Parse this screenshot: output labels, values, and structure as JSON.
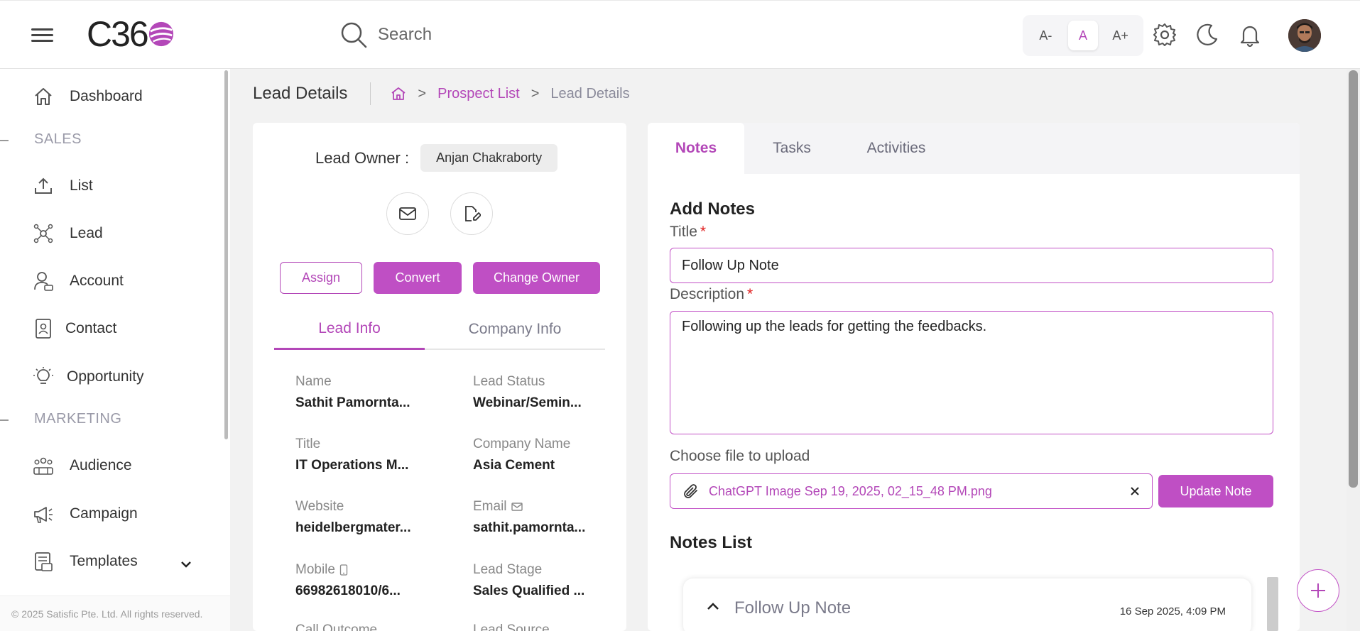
{
  "header": {
    "logo_text": "C36",
    "search_placeholder": "Search",
    "font_controls": [
      "A-",
      "A",
      "A+"
    ]
  },
  "sidebar": {
    "items": [
      {
        "label": "Dashboard",
        "icon": "home-icon"
      },
      {
        "label": "List",
        "icon": "upload-icon"
      },
      {
        "label": "Lead",
        "icon": "network-icon"
      },
      {
        "label": "Account",
        "icon": "user-account-icon"
      },
      {
        "label": "Contact",
        "icon": "contact-card-icon"
      },
      {
        "label": "Opportunity",
        "icon": "lightbulb-icon"
      },
      {
        "label": "Audience",
        "icon": "audience-icon"
      },
      {
        "label": "Campaign",
        "icon": "megaphone-icon"
      },
      {
        "label": "Templates",
        "icon": "templates-icon"
      }
    ],
    "sections": [
      "SALES",
      "MARKETING"
    ],
    "footer": "© 2025 Satisfic Pte. Ltd. All rights reserved."
  },
  "breadcrumb": {
    "page_title": "Lead Details",
    "link": "Prospect List",
    "current": "Lead Details",
    "chevron": ">"
  },
  "lead_card": {
    "owner_label": "Lead Owner :",
    "owner_name": "Anjan Chakraborty",
    "buttons": {
      "assign": "Assign",
      "convert": "Convert",
      "change_owner": "Change Owner"
    },
    "tabs": [
      "Lead Info",
      "Company Info"
    ],
    "fields": [
      {
        "label": "Name",
        "value": "Sathit Pamornta..."
      },
      {
        "label": "Lead Status",
        "value": "Webinar/Semin..."
      },
      {
        "label": "Title",
        "value": "IT Operations M..."
      },
      {
        "label": "Company Name",
        "value": "Asia Cement"
      },
      {
        "label": "Website",
        "value": "heidelbergmater..."
      },
      {
        "label": "Email",
        "value": "sathit.pamornta..."
      },
      {
        "label": "Mobile",
        "value": "66982618010/6..."
      },
      {
        "label": "Lead Stage",
        "value": "Sales Qualified ..."
      },
      {
        "label": "Call Outcome",
        "value": ""
      },
      {
        "label": "Lead Source",
        "value": ""
      }
    ]
  },
  "notes_panel": {
    "tabs": [
      "Notes",
      "Tasks",
      "Activities"
    ],
    "add_title": "Add Notes",
    "title_label": "Title",
    "title_value": "Follow Up Note",
    "description_label": "Description",
    "description_value": "Following up the leads for getting the feedbacks.",
    "required_mark": "*",
    "upload_label": "Choose file to upload",
    "file_name": "ChatGPT Image Sep 19, 2025, 02_15_48 PM.png",
    "update_button": "Update Note",
    "list_title": "Notes List",
    "notes": [
      {
        "title": "Follow Up Note",
        "date": "16 Sep 2025, 4:09 PM"
      }
    ]
  },
  "colors": {
    "accent": "#bf4fc4",
    "accent_text": "#b347b8"
  }
}
